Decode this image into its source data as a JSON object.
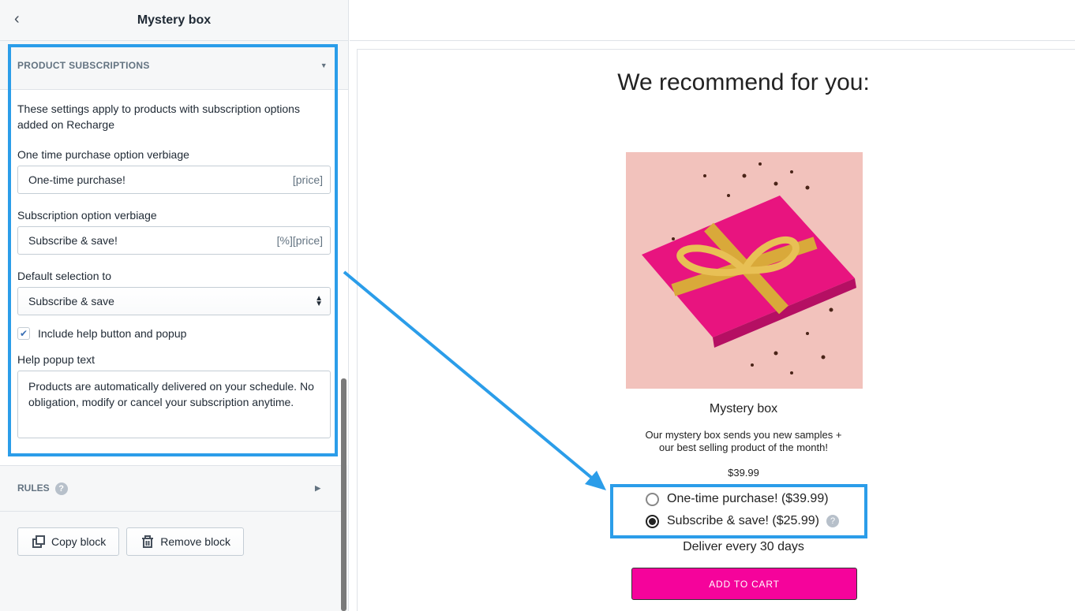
{
  "sidebar": {
    "title": "Mystery box",
    "section_title": "PRODUCT SUBSCRIPTIONS",
    "description": "These settings apply to products with subscription options added on Recharge",
    "one_time_label": "One time purchase option verbiage",
    "one_time_value": "One-time purchase!",
    "one_time_suffix": "[price]",
    "subscription_label": "Subscription option verbiage",
    "subscription_value": "Subscribe & save!",
    "subscription_suffix": "[%][price]",
    "default_label": "Default selection to",
    "default_value": "Subscribe & save",
    "help_checkbox_label": "Include help button and popup",
    "help_checkbox_checked": true,
    "help_text_label": "Help popup text",
    "help_text_value": "Products are automatically delivered on your schedule. No obligation, modify or cancel your subscription anytime.",
    "rules_label": "RULES",
    "copy_label": "Copy block",
    "remove_label": "Remove block"
  },
  "preview": {
    "heading": "We recommend for you:",
    "product_name": "Mystery box",
    "product_desc_1": "Our mystery box sends you new samples +",
    "product_desc_2": "our best selling product of the month!",
    "price": "$39.99",
    "option_one_time": "One-time purchase! ($39.99)",
    "option_subscribe": "Subscribe & save! ($25.99)",
    "selected_option": "subscribe",
    "delivery": "Deliver every 30 days",
    "add_to_cart": "ADD TO CART"
  },
  "colors": {
    "highlight": "#2b9de9",
    "cart_button": "#f5039b"
  }
}
